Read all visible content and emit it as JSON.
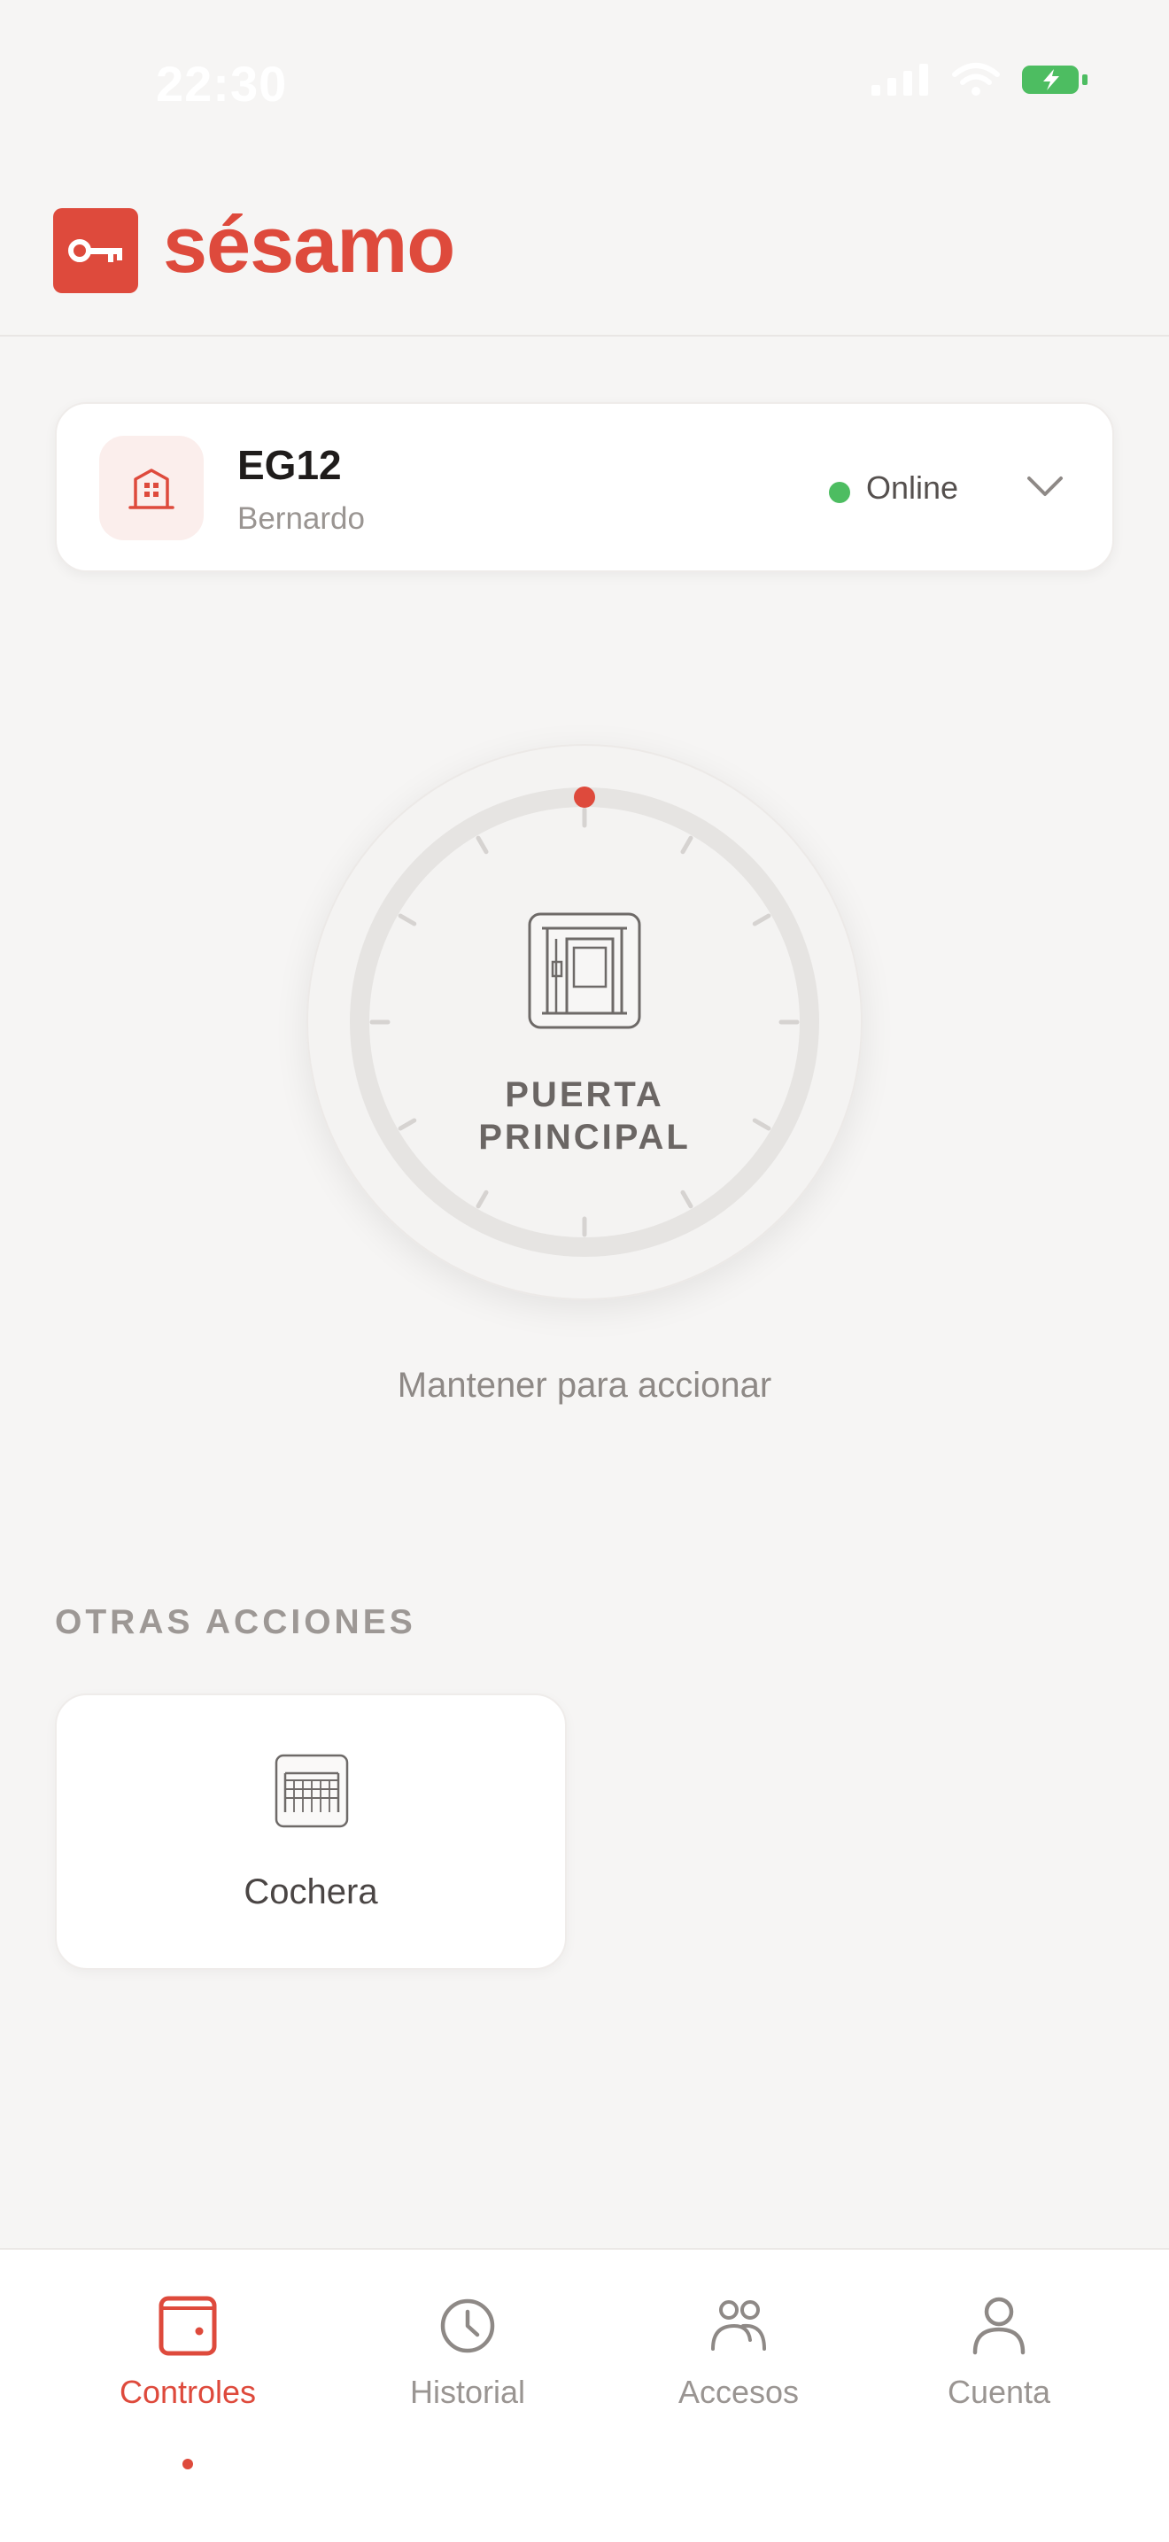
{
  "status_bar": {
    "time": "22:30"
  },
  "header": {
    "brand": "sésamo"
  },
  "location": {
    "name": "EG12",
    "owner": "Bernardo",
    "status": "Online"
  },
  "dial": {
    "title_line1": "PUERTA",
    "title_line2": "PRINCIPAL",
    "hint": "Mantener para accionar"
  },
  "other_actions": {
    "title": "OTRAS ACCIONES",
    "items": [
      {
        "label": "Cochera"
      }
    ]
  },
  "nav": {
    "items": [
      {
        "label": "Controles"
      },
      {
        "label": "Historial"
      },
      {
        "label": "Accesos"
      },
      {
        "label": "Cuenta"
      }
    ]
  },
  "colors": {
    "accent": "#de4a3c",
    "online": "#4dbd61",
    "battery": "#4dbd61"
  }
}
